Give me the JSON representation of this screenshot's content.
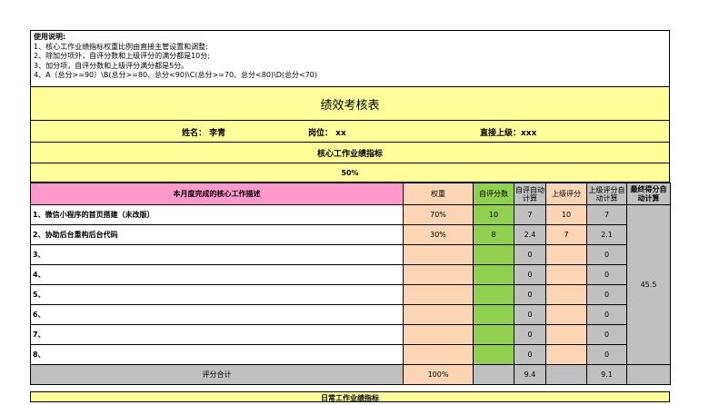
{
  "instructions": {
    "title": "使用说明:",
    "lines": [
      "1、核心工作业绩指标权重比例由直接主管设置和调整;",
      "2、除加分项外，自评分数和上级评分的满分都是10分;",
      "3、加分项，自评分数和上级评分满分都是5分。",
      "4、A（总分>=90）\\B(总分>=80、总分<90)\\C(总分>=70、总分<80)\\D(总分<70)"
    ]
  },
  "title": "绩效考核表",
  "info": {
    "name": "姓名：  李青",
    "position": "岗位：  xx",
    "supervisor": "直接上级：xxx"
  },
  "section_title": "核心工作业绩指标",
  "section_percent": "50%",
  "headers": {
    "desc": "本月度完成的核心工作描述",
    "weight": "权重",
    "self_score": "自评分数",
    "self_auto": "自评自动计算",
    "sup_score": "上级评分",
    "sup_auto": "上级评分自动计算",
    "final": "最终得分自动计算"
  },
  "rows": [
    {
      "desc": "1、微信小程序的首页搭建（未改版）",
      "weight": "70%",
      "self": "10",
      "self_auto": "7",
      "sup": "10",
      "sup_auto": "7"
    },
    {
      "desc": "2、协助后台重构后台代码",
      "weight": "30%",
      "self": "8",
      "self_auto": "2.4",
      "sup": "7",
      "sup_auto": "2.1"
    },
    {
      "desc": "3、",
      "weight": "",
      "self": "",
      "self_auto": "0",
      "sup": "",
      "sup_auto": "0"
    },
    {
      "desc": "4、",
      "weight": "",
      "self": "",
      "self_auto": "0",
      "sup": "",
      "sup_auto": "0"
    },
    {
      "desc": "5、",
      "weight": "",
      "self": "",
      "self_auto": "0",
      "sup": "",
      "sup_auto": "0"
    },
    {
      "desc": "6、",
      "weight": "",
      "self": "",
      "self_auto": "0",
      "sup": "",
      "sup_auto": "0"
    },
    {
      "desc": "7、",
      "weight": "",
      "self": "",
      "self_auto": "0",
      "sup": "",
      "sup_auto": "0"
    },
    {
      "desc": "8、",
      "weight": "",
      "self": "",
      "self_auto": "0",
      "sup": "",
      "sup_auto": "0"
    }
  ],
  "final_score": "45.5",
  "total": {
    "label": "评分合计",
    "weight": "100%",
    "self_auto": "9.4",
    "sup_auto": "9.1"
  },
  "bottom_band": "日常工作业绩指标",
  "colors": {
    "yellow": "#ffff99",
    "pink": "#ff99cc",
    "peach": "#fcd5b4",
    "green": "#92d050",
    "gray": "#c0c0c0"
  }
}
